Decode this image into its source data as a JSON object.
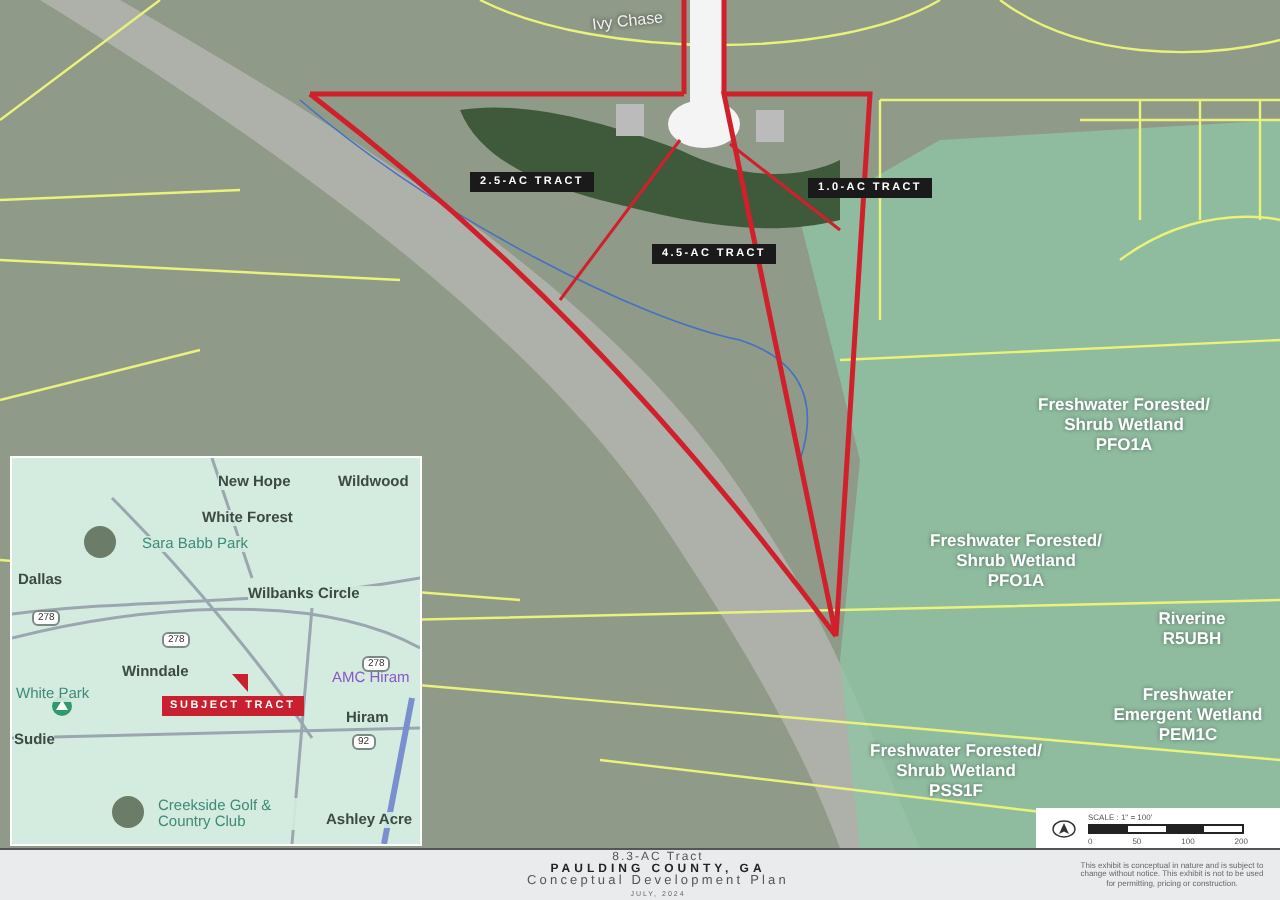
{
  "site_map": {
    "street_labels": [
      "Ivy Chase"
    ],
    "tract_labels": [
      "2.5-AC TRACT",
      "1.0-AC TRACT",
      "4.5-AC TRACT"
    ],
    "wetland_labels": [
      {
        "lines": [
          "Freshwater Forested/",
          "Shrub Wetland",
          "PFO1A"
        ]
      },
      {
        "lines": [
          "Freshwater Forested/",
          "Shrub Wetland",
          "PFO1A"
        ]
      },
      {
        "lines": [
          "Riverine",
          "R5UBH"
        ]
      },
      {
        "lines": [
          "Freshwater",
          "Emergent Wetland",
          "PEM1C"
        ]
      },
      {
        "lines": [
          "Freshwater Forested/",
          "Shrub Wetland",
          "PSS1F"
        ]
      }
    ]
  },
  "scale_bar": {
    "title": "SCALE : 1\" = 100'",
    "ticks": [
      "0",
      "50",
      "100",
      "200"
    ]
  },
  "location_map": {
    "places": [
      {
        "kind": "town",
        "text": "New Hope"
      },
      {
        "kind": "town",
        "text": "Wildwood"
      },
      {
        "kind": "town",
        "text": "White Forest"
      },
      {
        "kind": "park",
        "text": "Sara Babb Park"
      },
      {
        "kind": "town",
        "text": "Dallas"
      },
      {
        "kind": "town",
        "text": "Wilbanks Circle"
      },
      {
        "kind": "town",
        "text": "Winndale"
      },
      {
        "kind": "park",
        "text": "White Park"
      },
      {
        "kind": "poi",
        "text": "AMC Hiram"
      },
      {
        "kind": "town",
        "text": "Hiram"
      },
      {
        "kind": "town",
        "text": "Sudie"
      },
      {
        "kind": "park",
        "text": "Creekside Golf & Country Club"
      },
      {
        "kind": "town",
        "text": "Ashley Acre"
      }
    ],
    "route_shields": [
      "278",
      "278",
      "278",
      "92"
    ],
    "subject_label": "SUBJECT TRACT"
  },
  "footer": {
    "title": "8.3-AC Tract",
    "county": "PAULDING COUNTY, GA",
    "subtitle": "Conceptual Development Plan",
    "date": "JULY, 2024",
    "disclaimer": "This exhibit is conceptual in nature and is subject to change without notice. This exhibit is not to be used for permitting, pricing or construction."
  }
}
